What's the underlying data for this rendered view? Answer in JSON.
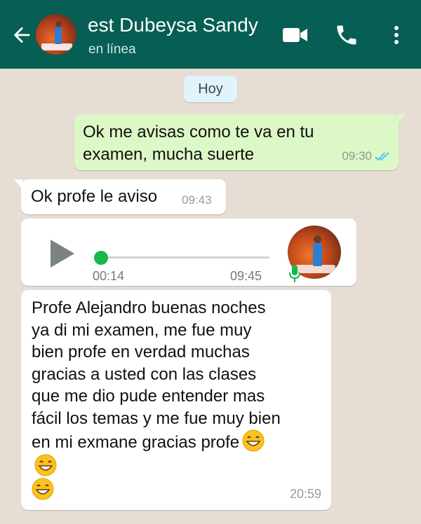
{
  "header": {
    "title": "est Dubeysa Sandy",
    "status": "en línea",
    "icons": [
      "back-arrow-icon",
      "video-camera-icon",
      "phone-icon",
      "more-vert-icon"
    ],
    "bg_color": "#075e54"
  },
  "chat": {
    "date_label": "Hoy",
    "messages": [
      {
        "direction": "out",
        "text": "Ok me avisas como te va en tu examen, mucha suerte",
        "time": "09:30",
        "read": true
      },
      {
        "direction": "in",
        "text": "Ok profe le aviso",
        "time": "09:43"
      },
      {
        "direction": "in",
        "type": "voice",
        "duration": "00:14",
        "time": "09:45",
        "progress": 0.0
      },
      {
        "direction": "in",
        "text": "Profe Alejandro buenas noches ya di mi examen, me fue muy bien profe en verdad muchas gracias a usted con las clases que me dio pude entender mas fácil los temas y me fue muy bien en mi exmane gracias profe",
        "emoji_count": 3,
        "time": "20:59"
      }
    ]
  },
  "colors": {
    "outgoing_bubble": "#dcf8c6",
    "incoming_bubble": "#ffffff",
    "read_ticks": "#4fc3f7",
    "voice_accent": "#16b84b"
  }
}
